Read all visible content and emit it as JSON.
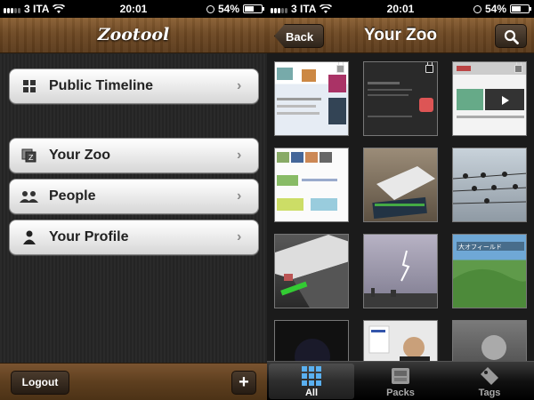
{
  "left_screen": {
    "status": {
      "carrier": "3 ITA",
      "time": "20:01",
      "battery": "54%",
      "battery_level": 0.54
    },
    "navbar": {
      "logo": "Zootool"
    },
    "menu": {
      "items": [
        {
          "label": "Public Timeline",
          "icon": "grid-icon"
        },
        {
          "label": "Your Zoo",
          "icon": "stack-icon"
        },
        {
          "label": "People",
          "icon": "people-icon"
        },
        {
          "label": "Your Profile",
          "icon": "person-icon"
        }
      ]
    },
    "bottombar": {
      "logout_label": "Logout",
      "add_label": "+"
    }
  },
  "right_screen": {
    "status": {
      "carrier": "3 ITA",
      "time": "20:01",
      "battery": "54%",
      "battery_level": 0.54
    },
    "navbar": {
      "back_label": "Back",
      "title": "Your Zoo"
    },
    "grid": {
      "items": [
        {
          "kind": "website screenshot",
          "locked": true
        },
        {
          "kind": "dark website screenshot",
          "locked": true
        },
        {
          "kind": "website screenshot",
          "locked": true
        },
        {
          "kind": "website screenshot",
          "locked": false
        },
        {
          "kind": "photo of device",
          "locked": false
        },
        {
          "kind": "birds on wire photo",
          "locked": false
        },
        {
          "kind": "photo",
          "locked": false
        },
        {
          "kind": "lightning sky photo",
          "locked": false
        },
        {
          "kind": "landscape photo",
          "locked": false
        },
        {
          "kind": "dark photo",
          "locked": false
        },
        {
          "kind": "presentation photo",
          "locked": false
        },
        {
          "kind": "portrait photo",
          "locked": false
        }
      ]
    },
    "tabbar": {
      "tabs": [
        {
          "label": "All",
          "icon": "grid-icon",
          "active": true
        },
        {
          "label": "Packs",
          "icon": "tray-icon",
          "active": false
        },
        {
          "label": "Tags",
          "icon": "tag-icon",
          "active": false
        }
      ]
    }
  }
}
